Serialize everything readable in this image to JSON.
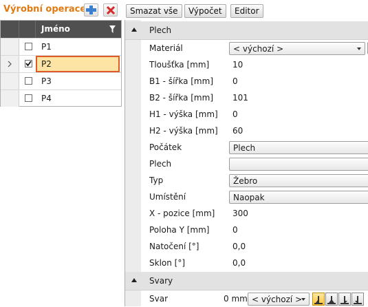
{
  "toolbar": {
    "title": "Výrobní operace",
    "add_icon": "add-icon",
    "delete_icon": "delete-icon",
    "clear_all_label": "Smazat vše",
    "calculate_label": "Výpočet",
    "editor_label": "Editor"
  },
  "grid": {
    "column_name": "Jméno",
    "rows": [
      {
        "name": "P1",
        "checked": false
      },
      {
        "name": "P2",
        "checked": true
      },
      {
        "name": "P3",
        "checked": false
      },
      {
        "name": "P4",
        "checked": false
      }
    ]
  },
  "panel": {
    "section_plate": "Plech",
    "material_label": "Materiál",
    "material_value": "< výchozí >",
    "thickness_label": "Tloušťka [mm]",
    "thickness_value": "10",
    "b1_label": "B1 - šířka [mm]",
    "b1_value": "0",
    "b2_label": "B2 - šířka [mm]",
    "b2_value": "101",
    "h1_label": "H1 - výška [mm]",
    "h1_value": "0",
    "h2_label": "H2 - výška [mm]",
    "h2_value": "60",
    "origin_label": "Počátek",
    "origin_value": "Plech",
    "plate_label": "Plech",
    "plate_value": "",
    "type_label": "Typ",
    "type_value": "Žebro",
    "placement_label": "Umístění",
    "placement_value": "Naopak",
    "xpos_label": "X - pozice [mm]",
    "xpos_value": "300",
    "ypos_label": "Poloha Y [mm]",
    "ypos_value": "0",
    "rotation_label": "Natočení [°]",
    "rotation_value": "0,0",
    "slope_label": "Sklon [°]",
    "slope_value": "0,0",
    "section_welds": "Svary",
    "weld_label": "Svar",
    "weld_size": "0 mm",
    "weld_material": "< výchozí >"
  },
  "colors": {
    "title": "#e07a10",
    "header_bg": "#505050",
    "selected_row": "#fde3a4",
    "selected_border": "#e05a28"
  }
}
